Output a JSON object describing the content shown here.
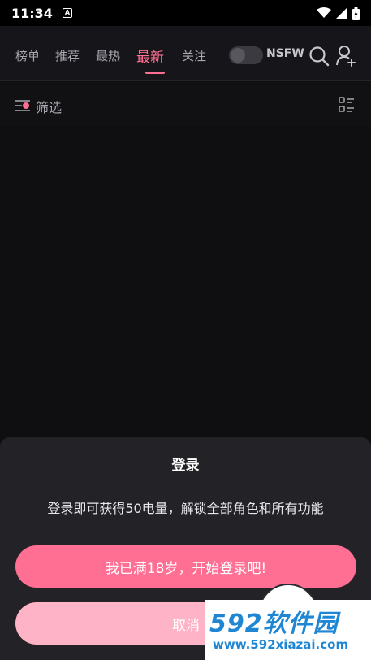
{
  "status_bar": {
    "time": "11:34",
    "notification_glyph": "A"
  },
  "nav": {
    "tabs": [
      {
        "label": "榜单"
      },
      {
        "label": "推荐"
      },
      {
        "label": "最热"
      },
      {
        "label": "最新"
      },
      {
        "label": "关注"
      }
    ],
    "active_tab": "最新",
    "nsfw_label": "NSFW",
    "nsfw_enabled": false
  },
  "filter": {
    "label": "筛选"
  },
  "login_sheet": {
    "title": "登录",
    "description": "登录即可获得50电量，解锁全部角色和所有功能",
    "primary_button": "我已满18岁，开始登录吧!",
    "secondary_button": "取消"
  },
  "watermark": {
    "logo": "592软件园",
    "url": "www.592xiazai.com"
  },
  "colors": {
    "accent": "#ff6f93",
    "accent_light": "#ffb3c6",
    "background": "#0f0f12",
    "sheet": "#232327"
  }
}
